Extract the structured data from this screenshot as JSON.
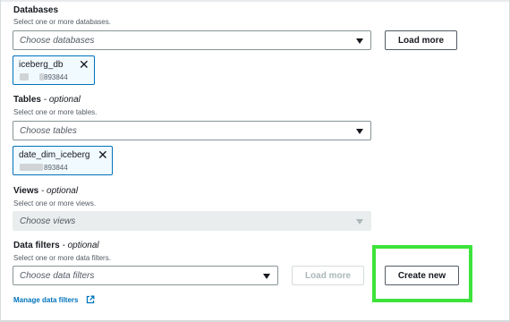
{
  "databases": {
    "label": "Databases",
    "description": "Select one or more databases.",
    "placeholder": "Choose databases",
    "load_more": "Load more",
    "token": {
      "name": "iceberg_db",
      "id": "893844"
    }
  },
  "tables": {
    "label": "Tables",
    "optional": "- optional",
    "description": "Select one or more tables.",
    "placeholder": "Choose tables",
    "token": {
      "name": "date_dim_iceberg",
      "id": "893844"
    }
  },
  "views": {
    "label": "Views",
    "optional": "- optional",
    "description": "Select one or more views.",
    "placeholder": "Choose views"
  },
  "data_filters": {
    "label": "Data filters",
    "optional": "- optional",
    "description": "Select one or more data filters.",
    "placeholder": "Choose data filters",
    "load_more": "Load more",
    "create_new": "Create new",
    "manage_link": "Manage data filters"
  },
  "colors": {
    "link": "#0073bb",
    "highlight": "#3de33a",
    "token_border": "#0073bb"
  }
}
